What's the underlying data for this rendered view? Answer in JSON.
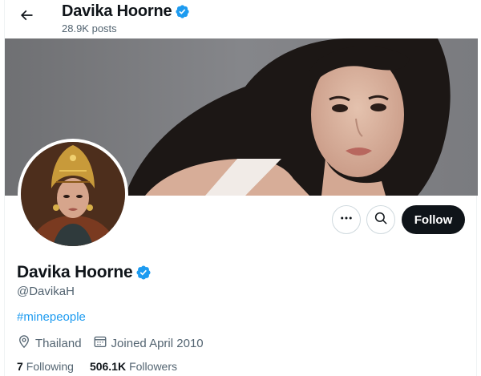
{
  "header": {
    "name": "Davika Hoorne",
    "posts": "28.9K posts"
  },
  "profile": {
    "display_name": "Davika Hoorne",
    "handle": "@DavikaH",
    "bio_hashtag": "#minepeople",
    "location": "Thailand",
    "joined": "Joined April 2010",
    "following_count": "7",
    "following_label": "Following",
    "followers_count": "506.1K",
    "followers_label": "Followers"
  },
  "actions": {
    "follow_label": "Follow"
  },
  "icons": {
    "back": "arrow-left-icon",
    "verified": "verified-badge-icon",
    "more": "more-horizontal-icon",
    "search": "search-icon",
    "location": "location-pin-icon",
    "calendar": "calendar-icon"
  },
  "colors": {
    "accent": "#1d9bf0",
    "text": "#0f1419",
    "muted": "#536471",
    "follow_bg": "#0f1419"
  }
}
